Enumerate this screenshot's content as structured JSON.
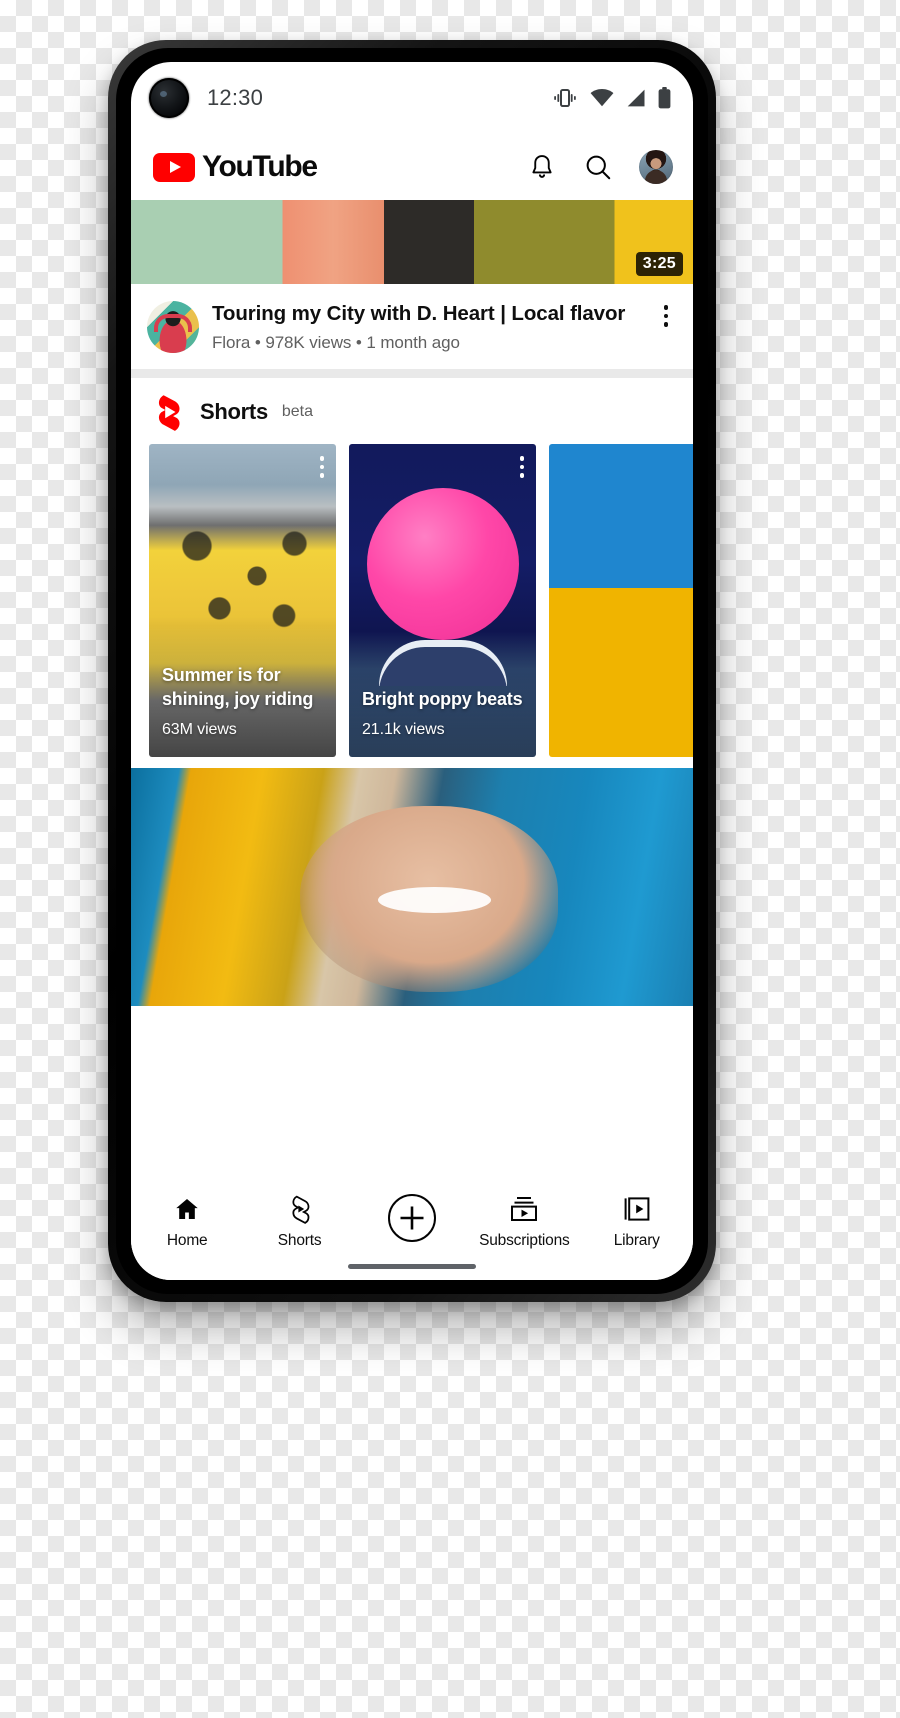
{
  "status_bar": {
    "time": "12:30",
    "icons": [
      "vibrate-icon",
      "wifi-icon",
      "cellular-signal-icon",
      "battery-icon"
    ]
  },
  "header": {
    "brand": "YouTube",
    "icons": [
      "notifications-bell-icon",
      "search-icon",
      "account-avatar"
    ]
  },
  "feed": {
    "video": {
      "duration": "3:25",
      "title": "Touring my City with D. Heart  | Local flavor",
      "channel": "Flora",
      "views": "978K views",
      "age": "1 month ago",
      "separator": "•",
      "menu": "more-options"
    }
  },
  "shorts": {
    "title": "Shorts",
    "badge": "beta",
    "cards": [
      {
        "caption": "Summer is for shining, joy riding",
        "views": "63M views"
      },
      {
        "caption": "Bright poppy beats",
        "views": "21.1k views"
      },
      {
        "caption": "",
        "views": ""
      }
    ]
  },
  "bottom_nav": {
    "items": [
      {
        "label": "Home",
        "icon": "home-icon"
      },
      {
        "label": "Shorts",
        "icon": "shorts-icon"
      },
      {
        "label": "",
        "icon": "create-plus-icon"
      },
      {
        "label": "Subscriptions",
        "icon": "subscriptions-icon"
      },
      {
        "label": "Library",
        "icon": "library-icon"
      }
    ]
  },
  "colors": {
    "brand_red": "#FF0000",
    "text_primary": "#0f0f0f",
    "text_secondary": "#606060",
    "divider": "#e9e9e9"
  }
}
